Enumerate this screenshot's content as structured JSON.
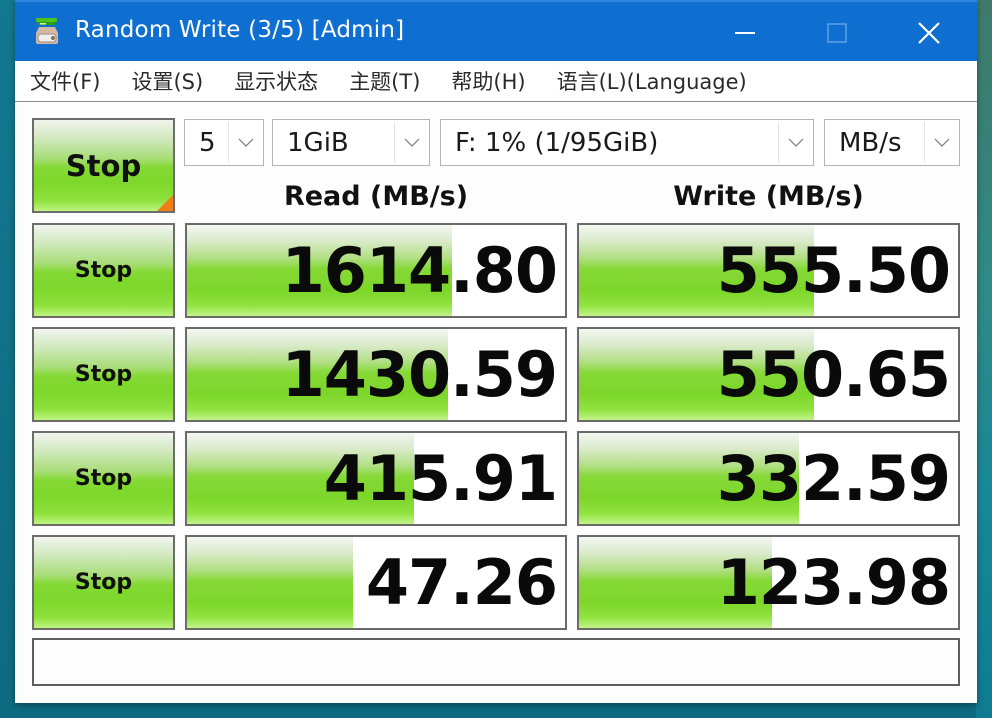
{
  "window": {
    "title": "Random Write (3/5) [Admin]",
    "icon": "disk-drive-icon",
    "controls": {
      "minimize": "minimize-icon",
      "maximize": "maximize-icon",
      "close": "close-icon"
    }
  },
  "menu": [
    {
      "label": "文件(F)"
    },
    {
      "label": "设置(S)"
    },
    {
      "label": "显示状态"
    },
    {
      "label": "主题(T)"
    },
    {
      "label": "帮助(H)"
    },
    {
      "label": "语言(L)(Language)"
    }
  ],
  "toolbar": {
    "all_button_label": "Stop",
    "count": "5",
    "size": "1GiB",
    "drive": "F: 1% (1/95GiB)",
    "unit": "MB/s"
  },
  "columns": {
    "read": "Read (MB/s)",
    "write": "Write (MB/s)"
  },
  "rows": [
    {
      "button": "Stop",
      "read": "1614.80",
      "read_fill": 0.7,
      "write": "555.50",
      "write_fill": 0.62
    },
    {
      "button": "Stop",
      "read": "1430.59",
      "read_fill": 0.69,
      "write": "550.65",
      "write_fill": 0.62
    },
    {
      "button": "Stop",
      "read": "415.91",
      "read_fill": 0.6,
      "write": "332.59",
      "write_fill": 0.58
    },
    {
      "button": "Stop",
      "read": "47.26",
      "read_fill": 0.44,
      "write": "123.98",
      "write_fill": 0.51
    }
  ],
  "status": "",
  "colors": {
    "titlebar": "#0f6fd0",
    "meter_green": "#7dd62a",
    "corner_accent": "#ef7d18"
  }
}
